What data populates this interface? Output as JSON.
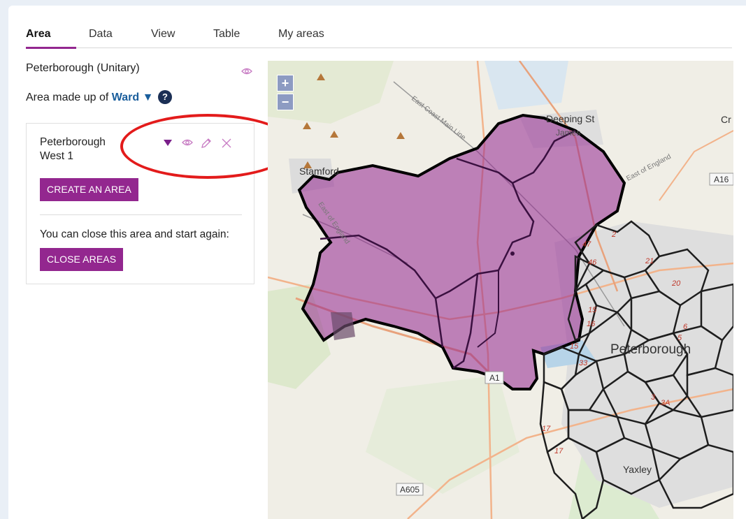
{
  "tabs": [
    {
      "label": "Area",
      "active": true
    },
    {
      "label": "Data",
      "active": false
    },
    {
      "label": "View",
      "active": false
    },
    {
      "label": "Table",
      "active": false
    },
    {
      "label": "My areas",
      "active": false
    }
  ],
  "area": {
    "title": "Peterborough (Unitary)",
    "made_up_prefix": "Area made up of",
    "made_up_type": "Ward",
    "help_symbol": "?"
  },
  "card": {
    "area_name": "Peterborough West 1",
    "create_label": "CREATE AN AREA",
    "close_text": "You can close this area and start again:",
    "close_label": "CLOSE AREAS"
  },
  "map": {
    "zoom_in": "+",
    "zoom_out": "−",
    "place_labels": [
      "Deeping St",
      "James",
      "Stamford",
      "Peterborough",
      "Yaxley",
      "Cr"
    ],
    "road_labels": [
      "A16",
      "A1",
      "A605"
    ],
    "rail_labels": [
      "East Coast Main Line",
      "East of England",
      "East of England"
    ],
    "ward_numbers": [
      "47",
      "46",
      "2",
      "21",
      "20",
      "15",
      "16",
      "15",
      "33",
      "6",
      "5",
      "3",
      "3A",
      "17",
      "17"
    ],
    "selection_color": "#93278f",
    "accent_color": "#93278f"
  },
  "annotation": {
    "highlight_color": "#e31b1b"
  }
}
